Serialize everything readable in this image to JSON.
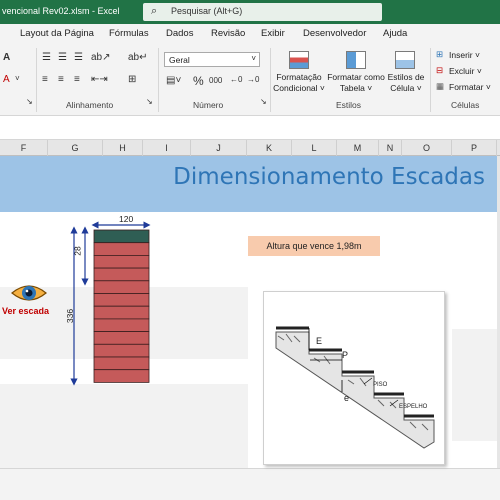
{
  "window": {
    "title": "vencional Rev02.xlsm  -  Excel",
    "search_placeholder": "Pesquisar (Alt+G)"
  },
  "ribbon": {
    "tabs": [
      "Layout da Página",
      "Fórmulas",
      "Dados",
      "Revisão",
      "Exibir",
      "Desenvolvedor",
      "Ajuda"
    ],
    "active_tab": "Layout da Página",
    "number_format": "Geral",
    "groups": {
      "alignment": "Alinhamento",
      "number": "Número",
      "styles": "Estilos",
      "cells": "Células"
    },
    "styles_buttons": {
      "conditional": "Formatação\nCondicional ˅",
      "table": "Formatar como\nTabela ˅",
      "cell_styles": "Estilos de\nCélula ˅"
    },
    "cells_buttons": {
      "insert": "Inserir  ˅",
      "delete": "Excluir  ˅",
      "format": "Formatar ˅"
    }
  },
  "columns": [
    "F",
    "G",
    "H",
    "I",
    "J",
    "K",
    "L",
    "M",
    "N",
    "O",
    "P"
  ],
  "sheet": {
    "title": "Dimensionamento Escadas",
    "height_label": "Altura que vence 1,98m",
    "view_button": "Ver escada",
    "stair_width": "120",
    "step_height": "28",
    "total_height": "336",
    "step_count": 12,
    "colors": {
      "banner": "#9dc3e6",
      "title": "#2e75b6",
      "top_step": "#2f5e54",
      "steps": "#c55a5a",
      "height_box": "#f8cbad",
      "arrows": "#1f3b99"
    }
  },
  "diagram_labels": {
    "e_upper": "E",
    "p": "P",
    "e_lower": "e",
    "piso": "PISO",
    "espelho": "ESPELHO"
  }
}
